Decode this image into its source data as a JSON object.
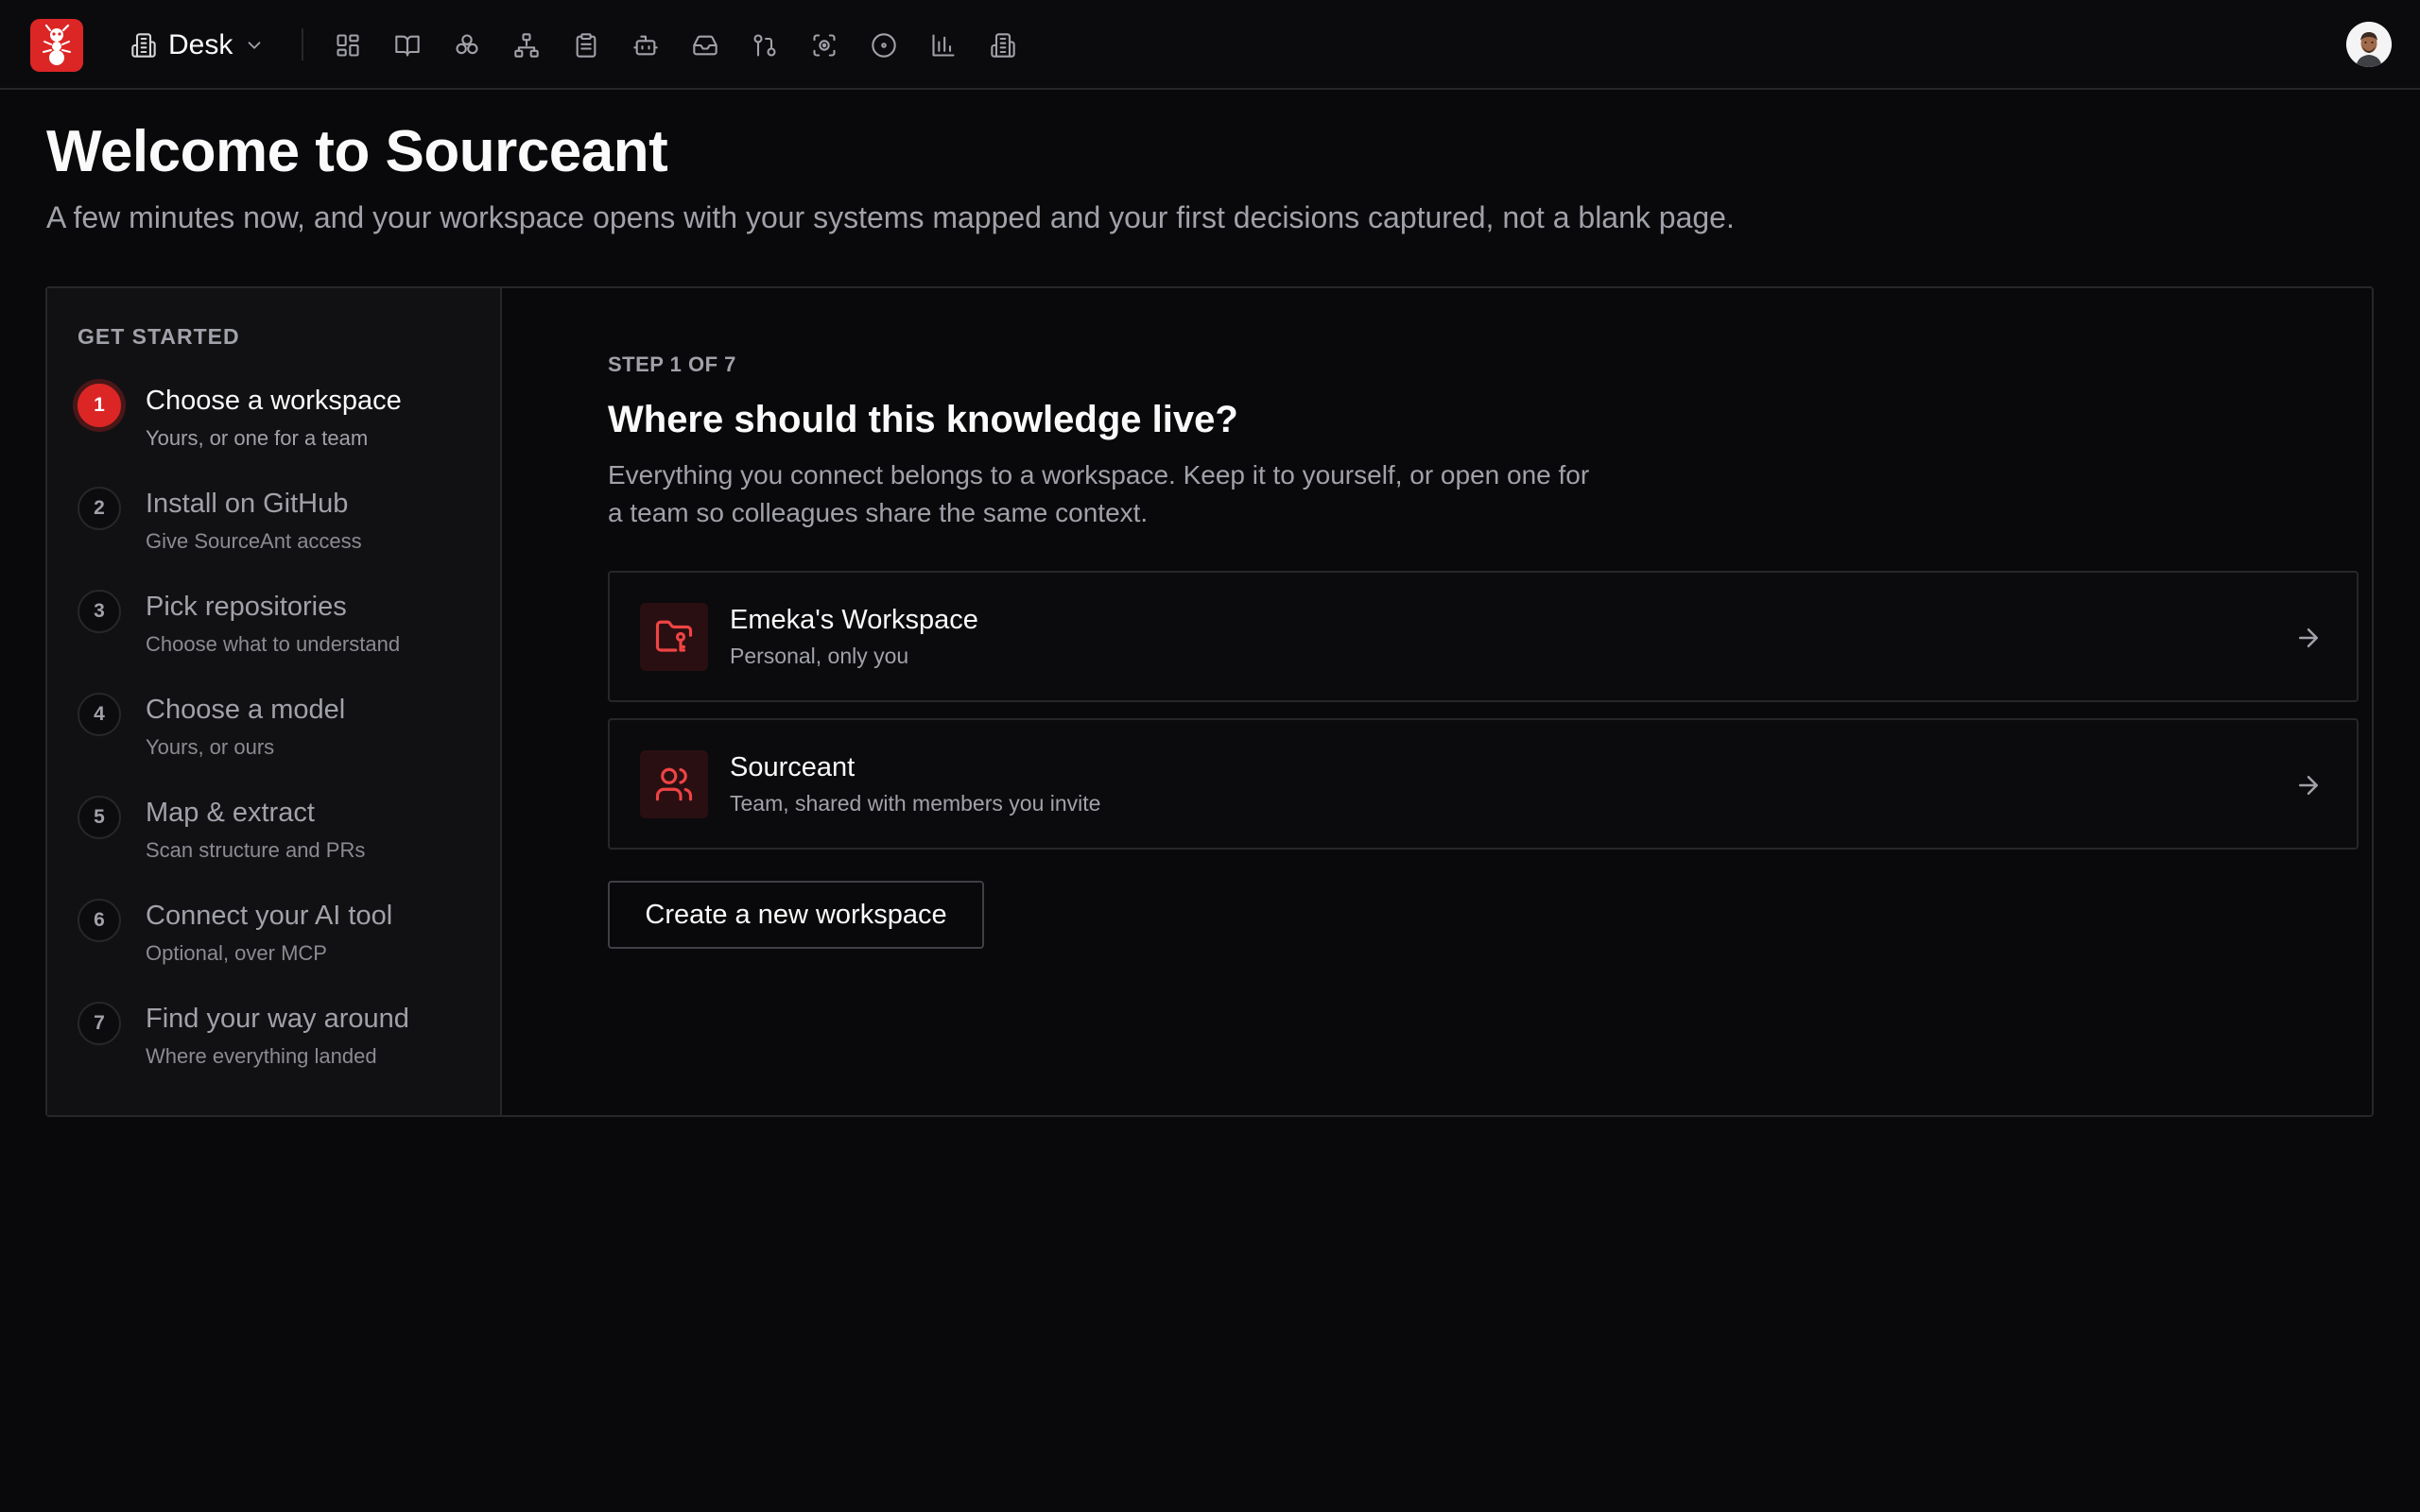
{
  "app": {
    "workspace_switcher_label": "Desk",
    "nav_icons": [
      "dashboard-icon",
      "book-icon",
      "components-icon",
      "sitemap-icon",
      "clipboard-icon",
      "bot-icon",
      "inbox-icon",
      "pull-request-icon",
      "scan-icon",
      "circle-dot-icon",
      "bar-chart-icon",
      "building-icon"
    ]
  },
  "header": {
    "title": "Welcome to Sourceant",
    "subtitle": "A few minutes now, and your workspace opens with your systems mapped and your first decisions captured, not a blank page."
  },
  "steps": {
    "heading": "GET STARTED",
    "items": [
      {
        "num": "1",
        "title": "Choose a workspace",
        "sub": "Yours, or one for a team",
        "active": true
      },
      {
        "num": "2",
        "title": "Install on GitHub",
        "sub": "Give SourceAnt access"
      },
      {
        "num": "3",
        "title": "Pick repositories",
        "sub": "Choose what to understand"
      },
      {
        "num": "4",
        "title": "Choose a model",
        "sub": "Yours, or ours"
      },
      {
        "num": "5",
        "title": "Map & extract",
        "sub": "Scan structure and PRs"
      },
      {
        "num": "6",
        "title": "Connect your AI tool",
        "sub": "Optional, over MCP"
      },
      {
        "num": "7",
        "title": "Find your way around",
        "sub": "Where everything landed"
      }
    ]
  },
  "content": {
    "step_label": "STEP 1 OF 7",
    "title": "Where should this knowledge live?",
    "description": "Everything you connect belongs to a workspace. Keep it to yourself, or open one for a team so colleagues share the same context.",
    "workspaces": [
      {
        "name": "Emeka's Workspace",
        "desc": "Personal, only you",
        "icon": "folder-key-icon"
      },
      {
        "name": "Sourceant",
        "desc": "Team, shared with members you invite",
        "icon": "users-icon"
      }
    ],
    "create_label": "Create a new workspace"
  },
  "colors": {
    "accent": "#dc2626",
    "background": "#09090b",
    "border": "#27272a"
  }
}
